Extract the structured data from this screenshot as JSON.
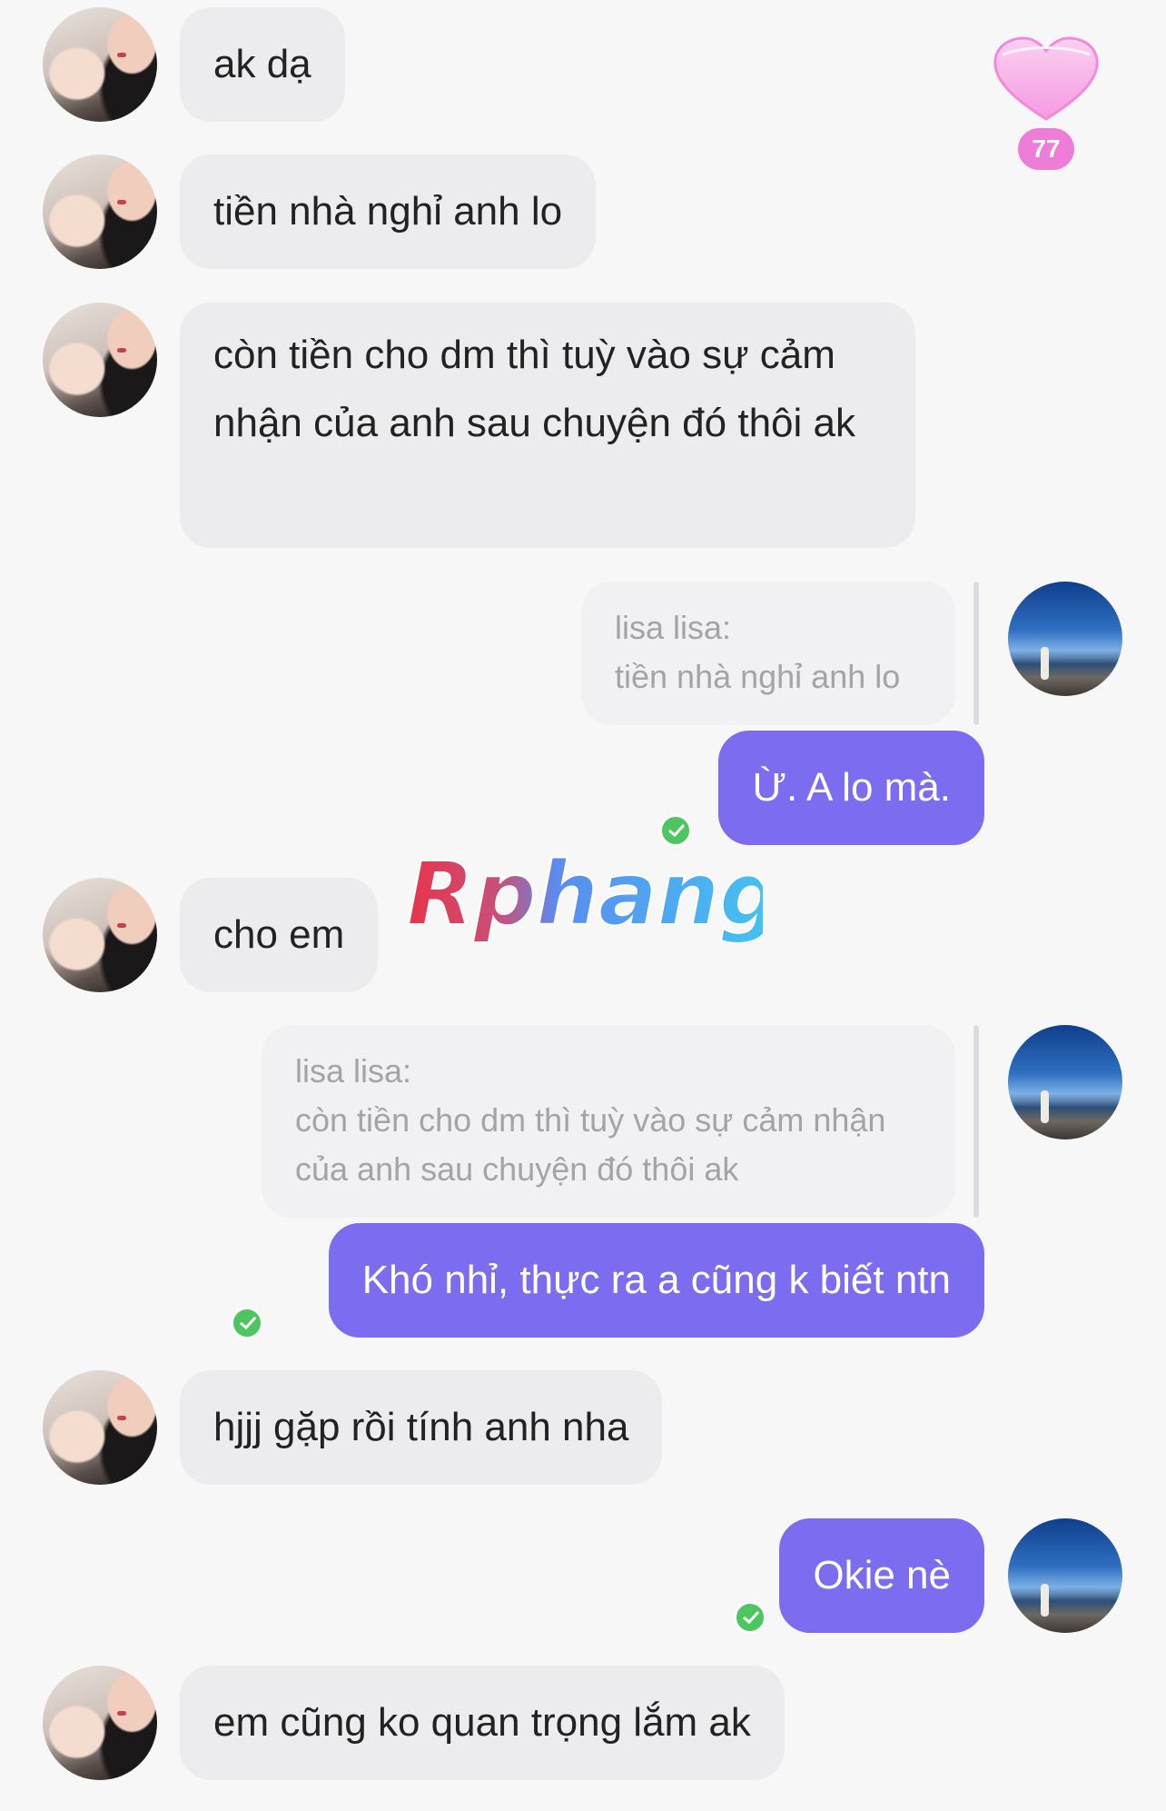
{
  "sidebar_badge": {
    "count": "77",
    "icon": "heart-icon"
  },
  "watermark": {
    "text": "Rphang"
  },
  "messages": [
    {
      "from": "her",
      "text": "ak dạ"
    },
    {
      "from": "her",
      "text": "tiền nhà nghỉ anh lo"
    },
    {
      "from": "her",
      "text": "còn tiền cho dm thì tuỳ vào sự cảm nhận của anh sau chuyện đó thôi ak"
    },
    {
      "from": "me",
      "quote_sender": "lisa lisa:",
      "quote_text": "tiền nhà nghỉ anh lo",
      "text": "Ừ. A lo mà."
    },
    {
      "from": "her",
      "text": "cho em"
    },
    {
      "from": "me",
      "quote_sender": "lisa lisa:",
      "quote_text": "còn tiền cho dm thì tuỳ vào sự cảm nhận của anh sau chuyện đó thôi ak",
      "text": "Khó nhỉ, thực ra a cũng k biết ntn"
    },
    {
      "from": "her",
      "text": "hjjj gặp rồi tính anh nha"
    },
    {
      "from": "me",
      "text": "Okie nè"
    },
    {
      "from": "her",
      "text": "em cũng ko quan trọng lắm ak"
    }
  ],
  "colors": {
    "background": "#f7f7f8",
    "incoming_bubble": "#ececee",
    "outgoing_bubble": "#7c6cf0",
    "sent_check": "#4cc65e",
    "badge": "#ee7dd8"
  }
}
